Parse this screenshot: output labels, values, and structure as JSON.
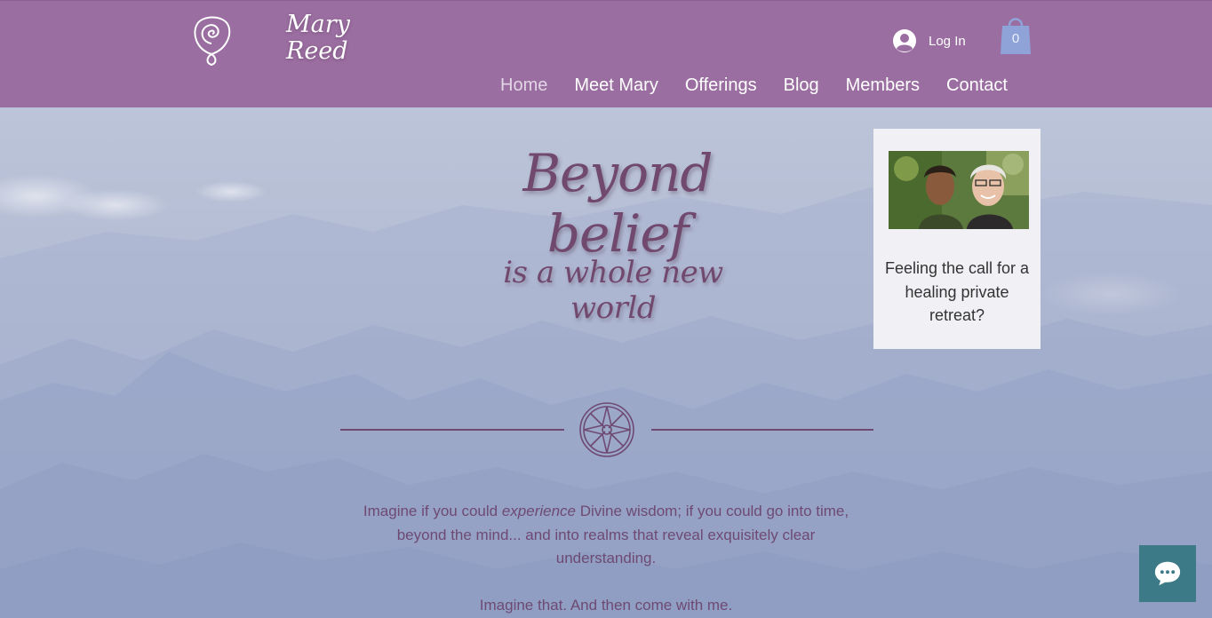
{
  "header": {
    "brand_line1": "Mary",
    "brand_line2": "Reed",
    "login_label": "Log In",
    "cart_count": "0",
    "nav": [
      {
        "label": "Home",
        "active": true
      },
      {
        "label": "Meet Mary",
        "active": false
      },
      {
        "label": "Offerings",
        "active": false
      },
      {
        "label": "Blog",
        "active": false
      },
      {
        "label": "Members",
        "active": false
      },
      {
        "label": "Contact",
        "active": false
      }
    ]
  },
  "hero": {
    "headline": "Beyond belief",
    "subhead": "is a whole new world",
    "body_pre": "Imagine if you could ",
    "body_em": "experience",
    "body_post": " Divine wisdom; if you could go into time, beyond the mind... and into realms that reveal exquisitely clear understanding.",
    "body_p2": "Imagine that. And then come with me."
  },
  "promo": {
    "text": "Feeling the call for a healing private retreat?"
  },
  "icons": {
    "logo": "spiral-drop-icon",
    "avatar": "user-avatar-icon",
    "cart": "shopping-bag-icon",
    "compass": "compass-rose-icon",
    "chat": "chat-bubble-icon"
  },
  "colors": {
    "header_bg": "#9a6ea0",
    "accent_text": "#71496e",
    "cart": "#8fa3d8",
    "chat_bg": "#3b7a86",
    "promo_bg": "#f1f1f5"
  }
}
